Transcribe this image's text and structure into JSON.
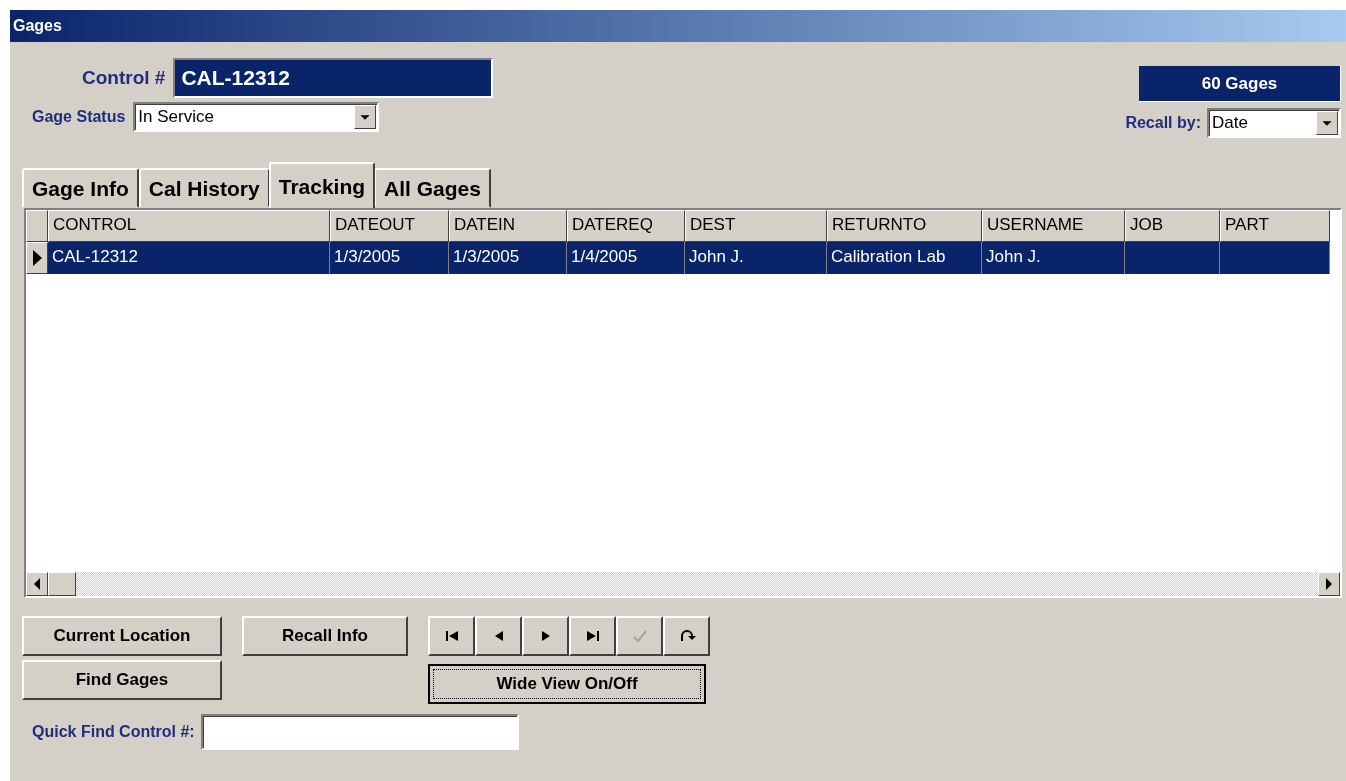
{
  "window": {
    "title": "Gages"
  },
  "control": {
    "label": "Control #",
    "value": "CAL-12312"
  },
  "gage_count": "60 Gages",
  "gage_status": {
    "label": "Gage Status",
    "value": "In Service"
  },
  "recall_by": {
    "label": "Recall by:",
    "value": "Date"
  },
  "tabs": [
    {
      "label": "Gage Info",
      "selected": false
    },
    {
      "label": "Cal History",
      "selected": false
    },
    {
      "label": "Tracking",
      "selected": true
    },
    {
      "label": "All Gages",
      "selected": false
    }
  ],
  "table": {
    "columns": [
      "CONTROL",
      "DATEOUT",
      "DATEIN",
      "DATEREQ",
      "DEST",
      "RETURNTO",
      "USERNAME",
      "JOB",
      "PART"
    ],
    "rows": [
      {
        "selected": true,
        "cells": [
          "CAL-12312",
          "1/3/2005",
          "1/3/2005",
          "1/4/2005",
          "John J.",
          "Calibration Lab",
          "John J.",
          "",
          ""
        ]
      }
    ]
  },
  "buttons": [
    {
      "label": "Current Location"
    },
    {
      "label": "Recall Info"
    },
    {
      "label": "Find Gages"
    }
  ],
  "nav_buttons": [
    {
      "kind": "first",
      "disabled": false
    },
    {
      "kind": "prev",
      "disabled": false
    },
    {
      "kind": "next",
      "disabled": false
    },
    {
      "kind": "last",
      "disabled": false
    },
    {
      "kind": "save",
      "disabled": true
    },
    {
      "kind": "undo",
      "disabled": false
    }
  ],
  "wide_view_button": {
    "label": "Wide View On/Off"
  },
  "quick_find": {
    "label": "Quick Find Control #:"
  }
}
